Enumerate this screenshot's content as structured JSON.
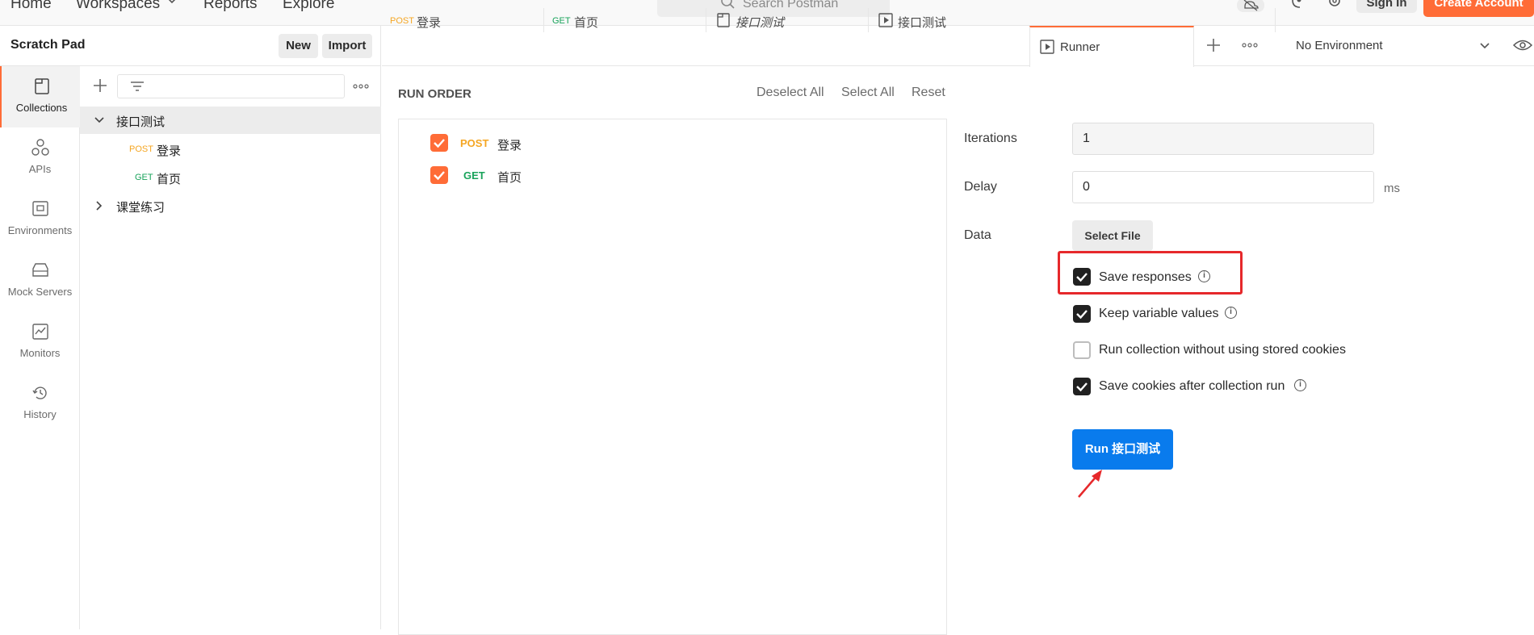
{
  "topnav": {
    "home": "Home",
    "workspaces": "Workspaces",
    "reports": "Reports",
    "explore": "Explore",
    "search_placeholder": "Search Postman",
    "signin": "Sign In",
    "create_account": "Create Account"
  },
  "sidebar": {
    "title": "Scratch Pad",
    "new_label": "New",
    "import_label": "Import",
    "rail": [
      {
        "label": "Collections",
        "icon": "collections-icon"
      },
      {
        "label": "APIs",
        "icon": "apis-icon"
      },
      {
        "label": "Environments",
        "icon": "environments-icon"
      },
      {
        "label": "Mock Servers",
        "icon": "mock-servers-icon"
      },
      {
        "label": "Monitors",
        "icon": "monitors-icon"
      },
      {
        "label": "History",
        "icon": "history-icon"
      }
    ],
    "tree": [
      {
        "label": "接口测试"
      },
      {
        "method": "POST",
        "label": "登录"
      },
      {
        "method": "GET",
        "label": "首页"
      },
      {
        "label": "课堂练习"
      }
    ]
  },
  "tabs": [
    {
      "method": "POST",
      "label": "登录"
    },
    {
      "method": "GET",
      "label": "首页"
    },
    {
      "label": "接口测试"
    },
    {
      "label": "接口测试"
    },
    {
      "label": "Runner"
    }
  ],
  "environment": "No Environment",
  "runner": {
    "run_order_title": "RUN ORDER",
    "deselect_all": "Deselect All",
    "select_all": "Select All",
    "reset": "Reset",
    "requests": [
      {
        "method": "POST",
        "label": "登录"
      },
      {
        "method": "GET",
        "label": "首页"
      }
    ],
    "iterations_label": "Iterations",
    "iterations_value": "1",
    "delay_label": "Delay",
    "delay_value": "0",
    "delay_unit": "ms",
    "data_label": "Data",
    "select_file": "Select File",
    "options": [
      {
        "label": "Save responses",
        "checked": true
      },
      {
        "label": "Keep variable values",
        "checked": true
      },
      {
        "label": "Run collection without using stored cookies",
        "checked": false
      },
      {
        "label": "Save cookies after collection run",
        "checked": true
      }
    ],
    "run_button": "Run 接口测试"
  },
  "colors": {
    "accent": "#ff6c37",
    "run_button": "#097bed",
    "annotation": "#e6282b"
  }
}
